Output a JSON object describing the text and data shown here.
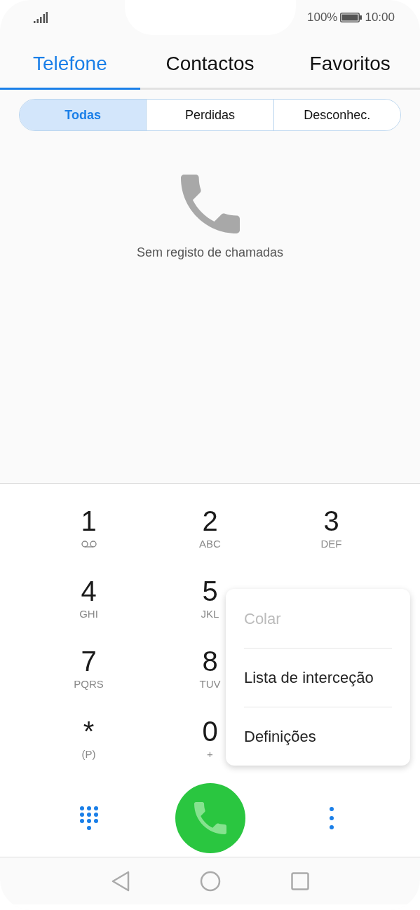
{
  "status_bar": {
    "battery": "100%",
    "time": "10:00"
  },
  "tabs": [
    {
      "label": "Telefone",
      "selected": true
    },
    {
      "label": "Contactos",
      "selected": false
    },
    {
      "label": "Favoritos",
      "selected": false
    }
  ],
  "filters": [
    {
      "label": "Todas",
      "selected": true
    },
    {
      "label": "Perdidas",
      "selected": false
    },
    {
      "label": "Desconhec.",
      "selected": false
    }
  ],
  "empty_state": {
    "message": "Sem registo de chamadas"
  },
  "keypad_rows": [
    [
      {
        "digit": "1",
        "kind": "voicemail"
      },
      {
        "digit": "2",
        "kind": "letters",
        "letters": "ABC"
      },
      {
        "digit": "3",
        "kind": "letters",
        "letters": "DEF"
      }
    ],
    [
      {
        "digit": "4",
        "kind": "letters",
        "letters": "GHI"
      },
      {
        "digit": "5",
        "kind": "letters",
        "letters": "JKL"
      }
    ],
    [
      {
        "digit": "7",
        "kind": "letters",
        "letters": "PQRS"
      },
      {
        "digit": "8",
        "kind": "letters",
        "letters": "TUV"
      }
    ],
    [
      {
        "digit": "*",
        "kind": "letters",
        "letters": "(P)"
      },
      {
        "digit": "0",
        "kind": "letters",
        "letters": "+"
      }
    ]
  ],
  "menu": {
    "items": [
      {
        "label": "Colar",
        "disabled": true
      },
      {
        "label": "Lista de interceção",
        "disabled": false
      },
      {
        "label": "Definições",
        "disabled": false
      }
    ]
  }
}
